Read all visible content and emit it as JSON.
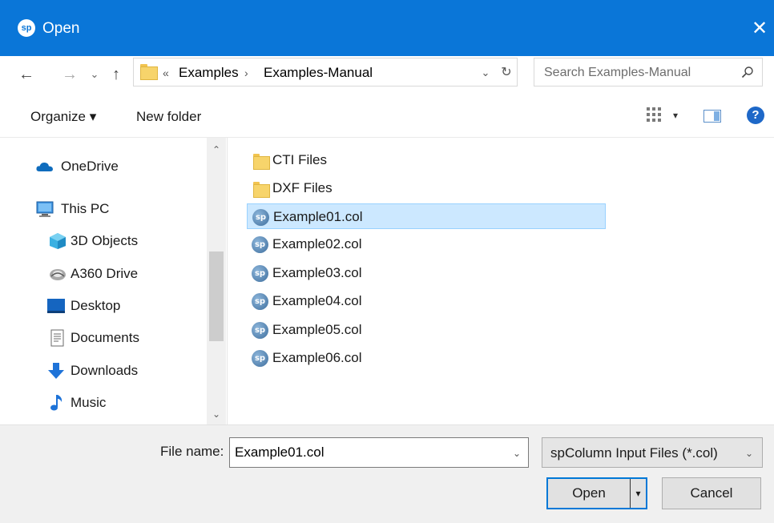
{
  "window": {
    "title": "Open",
    "app_badge": "sp",
    "close_glyph": "✕"
  },
  "nav": {
    "back_glyph": "←",
    "forward_glyph": "→",
    "recent_glyph": "⌄",
    "up_glyph": "↑"
  },
  "address": {
    "overflow": "«",
    "crumbs": [
      "Examples",
      "Examples-Manual"
    ],
    "separator": "›",
    "dropdown_glyph": "⌄",
    "refresh_glyph": "↻"
  },
  "search": {
    "placeholder": "Search Examples-Manual",
    "icon": "search-icon"
  },
  "toolbar": {
    "organize_label": "Organize ▾",
    "new_folder_label": "New folder",
    "view_dropdown_glyph": "▾",
    "help_glyph": "?"
  },
  "sidebar": {
    "scroll_up_glyph": "⌃",
    "scroll_down_glyph": "⌄",
    "items": [
      {
        "label": "OneDrive",
        "icon": "cloud-icon"
      },
      {
        "label": "This PC",
        "icon": "computer-icon"
      },
      {
        "label": "3D Objects",
        "icon": "cube-icon"
      },
      {
        "label": "A360 Drive",
        "icon": "drive-icon"
      },
      {
        "label": "Desktop",
        "icon": "desktop-icon"
      },
      {
        "label": "Documents",
        "icon": "document-icon"
      },
      {
        "label": "Downloads",
        "icon": "download-icon"
      },
      {
        "label": "Music",
        "icon": "music-note-icon"
      }
    ]
  },
  "files": [
    {
      "name": "CTI Files",
      "type": "folder"
    },
    {
      "name": "DXF Files",
      "type": "folder"
    },
    {
      "name": "Example01.col",
      "type": "file",
      "selected": true
    },
    {
      "name": "Example02.col",
      "type": "file"
    },
    {
      "name": "Example03.col",
      "type": "file"
    },
    {
      "name": "Example04.col",
      "type": "file"
    },
    {
      "name": "Example05.col",
      "type": "file"
    },
    {
      "name": "Example06.col",
      "type": "file"
    }
  ],
  "file_badge": "sp",
  "footer": {
    "file_name_label": "File name:",
    "file_name_value": "Example01.col",
    "file_name_dropdown_glyph": "⌄",
    "filter_value": "spColumn Input Files (*.col)",
    "filter_dropdown_glyph": "⌄",
    "open_label": "Open",
    "open_split_glyph": "▾",
    "cancel_label": "Cancel"
  },
  "colors": {
    "titlebar": "#0a76d8",
    "selection": "#cce8ff",
    "selection_border": "#99d1ff",
    "primary_button_border": "#0078d7"
  }
}
